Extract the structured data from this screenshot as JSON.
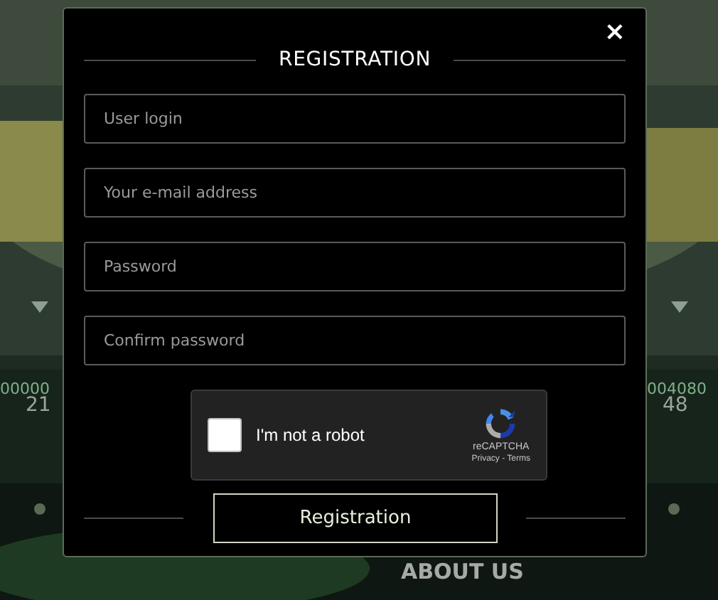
{
  "background": {
    "texts": [
      {
        "kind": "ticker",
        "text": "00000"
      },
      {
        "kind": "count",
        "text": "21"
      },
      {
        "kind": "ticker",
        "text": "004080"
      },
      {
        "kind": "count",
        "text": "48"
      },
      {
        "kind": "nav",
        "text": "ABOUT US"
      }
    ]
  },
  "dialog": {
    "title": "REGISTRATION",
    "close": "×",
    "fields": [
      {
        "placeholder": "User login"
      },
      {
        "placeholder": "Your e-mail address"
      },
      {
        "placeholder": "Password"
      },
      {
        "placeholder": "Confirm password"
      }
    ],
    "captcha": {
      "label": "I'm not a robot",
      "checked": false,
      "brand": "reCAPTCHA",
      "links": "Privacy - Terms"
    },
    "submit": "Registration"
  }
}
